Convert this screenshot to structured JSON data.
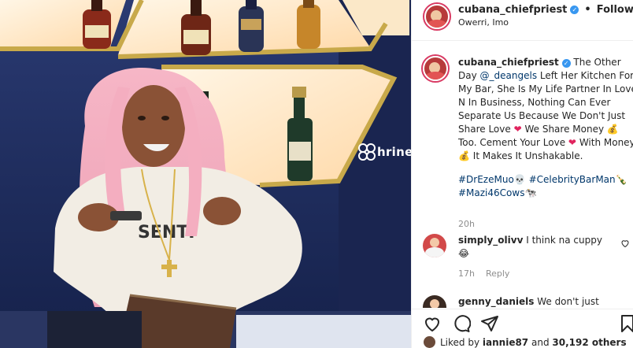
{
  "watermark": {
    "text": "hrine"
  },
  "post": {
    "author": {
      "username": "cubana_chiefpriest",
      "verified": true,
      "location": "Owerri, Imo",
      "follow_status": "Following"
    },
    "caption": {
      "username": "cubana_chiefpriest",
      "part1": "The Other Day",
      "mention": "@_deangels",
      "part2": "Left Her Kitchen For My Bar, She Is My Life Partner In Love N In Business, Nothing Can Ever Separate Us Because We Don't Just Share Love",
      "heart1": "❤",
      "part3": "We Share Money",
      "money1": "💰",
      "part4": "Too. Cement Your Love",
      "heart2": "❤",
      "part5": "With Money",
      "money2": "💰",
      "part6": "It Makes It Unshakable.",
      "hashtag1": "#DrEzeMuo",
      "hashtag1_emoji": "💀",
      "hashtag2": "#CelebrityBarMan",
      "hashtag2_emoji": "🍾",
      "hashtag3": "#Mazi46Cows",
      "hashtag3_emoji": "🐄",
      "time": "20h"
    },
    "comments": [
      {
        "username": "simply_olivv",
        "text": "I think na cuppy",
        "emoji": "😂",
        "time": "17h",
        "reply_label": "Reply"
      },
      {
        "username": "genny_daniels",
        "text": "We don't just"
      }
    ],
    "likes": {
      "text_prefix": "Liked by",
      "liker": "iannie87",
      "text_mid": "and",
      "others": "30,192 others"
    }
  }
}
